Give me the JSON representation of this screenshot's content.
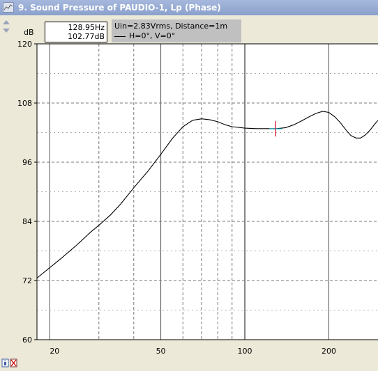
{
  "window": {
    "title": "9. Sound Pressure of PAUDIO-1, Lp (Phase)"
  },
  "readout": {
    "freq": "128.95Hz",
    "level": "102.77dB"
  },
  "legend": {
    "line1": "Uin=2.83Vrms, Distance=1m",
    "line2": "H=0°, V=0°"
  },
  "chart_data": {
    "type": "line",
    "title": "",
    "xlabel": "",
    "ylabel": "dB",
    "xscale": "log",
    "xlim": [
      18,
      300
    ],
    "ylim": [
      60,
      120
    ],
    "x_ticks": [
      20,
      50,
      100,
      200
    ],
    "y_ticks": [
      60,
      72,
      84,
      96,
      108,
      120
    ],
    "grid": true,
    "background": "#ffffff",
    "line_color": "#000000",
    "cursor": {
      "x": 128.95,
      "y": 102.77
    },
    "series": [
      {
        "name": "",
        "x": [
          18,
          20,
          22,
          25,
          28,
          30,
          33,
          36,
          40,
          45,
          50,
          55,
          60,
          65,
          70,
          75,
          80,
          85,
          90,
          100,
          110,
          120,
          130,
          140,
          150,
          160,
          170,
          180,
          190,
          200,
          210,
          220,
          230,
          240,
          250,
          260,
          270,
          280,
          290,
          300
        ],
        "y": [
          72.5,
          74.6,
          76.5,
          79.2,
          81.8,
          83.2,
          85.3,
          87.6,
          90.8,
          94.2,
          97.6,
          100.8,
          103.2,
          104.5,
          104.8,
          104.6,
          104.2,
          103.6,
          103.2,
          102.9,
          102.8,
          102.8,
          102.8,
          103.0,
          103.6,
          104.4,
          105.2,
          105.9,
          106.3,
          106.1,
          105.2,
          104.0,
          102.6,
          101.4,
          100.9,
          100.9,
          101.5,
          102.4,
          103.5,
          104.5
        ]
      }
    ]
  }
}
